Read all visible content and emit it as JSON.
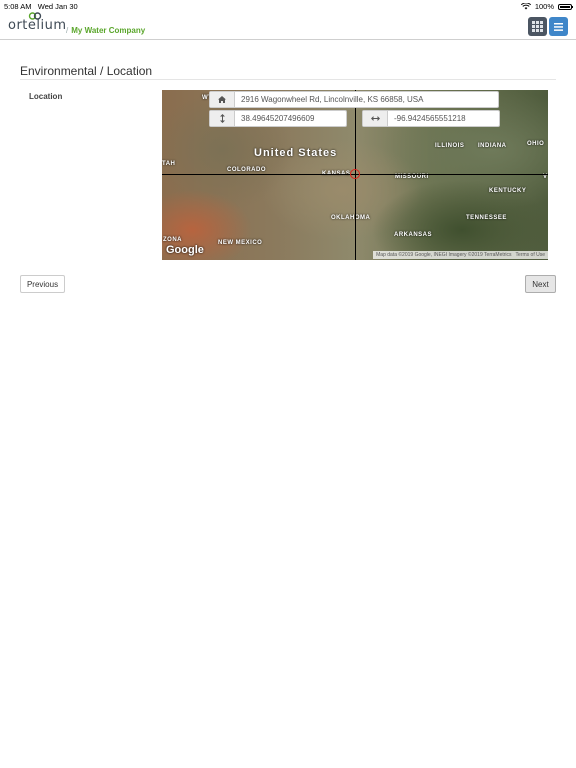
{
  "status_bar": {
    "time": "5:08 AM",
    "date": "Wed Jan 30",
    "battery": "100%"
  },
  "header": {
    "logo_text": "ortelium",
    "company": "My Water Company",
    "icons": [
      "grid-icon",
      "menu-icon"
    ]
  },
  "page": {
    "title": "Environmental / Location"
  },
  "location": {
    "label": "Location",
    "address": "2916 Wagonwheel Rd, Lincolnville, KS 66858, USA",
    "latitude": "38.49645207496609",
    "longitude": "-96.9424565551218"
  },
  "map": {
    "country_label": "United States",
    "state_labels": {
      "colorado": "COLORADO",
      "kansas": "KANSAS",
      "missouri": "MISSOURI",
      "illinois": "ILLINOIS",
      "indiana": "INDIANA",
      "ohio": "OHIO",
      "kentucky": "KENTUCKY",
      "tennessee": "TENNESSEE",
      "oklahoma": "OKLAHOMA",
      "arkansas": "ARKANSAS",
      "new_mexico": "NEW MEXICO",
      "arizona_partial": "ZONA",
      "utah_partial": "TAH",
      "wyoming_partial": "WY",
      "virginia_partial": "V"
    },
    "google_logo": "Google",
    "attribution": "Map data ©2019 Google, INEGI Imagery ©2019 TerraMetrics",
    "terms": "Terms of Use"
  },
  "nav": {
    "previous": "Previous",
    "next": "Next"
  },
  "colors": {
    "company_green": "#5aa62b",
    "menu_blue": "#3f86c9",
    "grid_dark": "#4b5562",
    "marker_red": "#e0201a"
  }
}
